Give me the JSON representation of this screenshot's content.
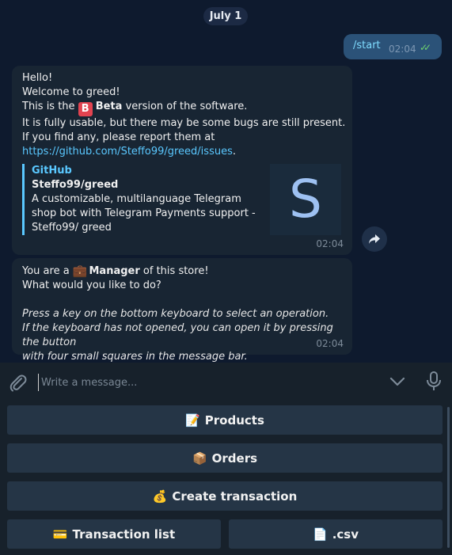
{
  "date_label": "July 1",
  "outgoing": {
    "text": "/start",
    "time": "02:04",
    "ticks": "✓✓"
  },
  "welcome": {
    "line1": "Hello!",
    "line2": "Welcome to greed!",
    "line3_pre": "This is the",
    "beta_icon": "B",
    "beta_word": "Beta",
    "line3_post": "version of the software.",
    "line4": "It is fully usable, but there may be some bugs are still present.",
    "line5": "If you find any, please report them at",
    "link": "https://github.com/Steffo99/greed/issues",
    "link_tail": ".",
    "preview": {
      "site": "GitHub",
      "title": "Steffo99/greed",
      "desc": "A customizable, multilanguage Telegram shop bot with Telegram Payments support - Steffo99/ greed",
      "thumb_letter": "S"
    },
    "time": "02:04"
  },
  "manager": {
    "pre": "You are a",
    "emoji": "💼",
    "role": "Manager",
    "post": "of this store!",
    "line2": "What would you like to do?",
    "italic1": "Press a key on the bottom keyboard to select an operation.",
    "italic2": "If the keyboard has not opened, you can open it by pressing the button",
    "italic3": "with four small squares in the message bar.",
    "time": "02:04"
  },
  "composer": {
    "placeholder": "Write a message..."
  },
  "keyboard": [
    {
      "emoji": "📝",
      "label": "Products"
    },
    {
      "emoji": "📦",
      "label": "Orders"
    },
    {
      "emoji": "💰",
      "label": "Create transaction"
    },
    {
      "emoji": "💳",
      "label": "Transaction list"
    },
    {
      "emoji": "📄",
      "label": ".csv"
    }
  ],
  "colors": {
    "link": "#5ac8ff",
    "beta_badge": "#e24350",
    "outgoing_bubble": "#2b5278"
  }
}
